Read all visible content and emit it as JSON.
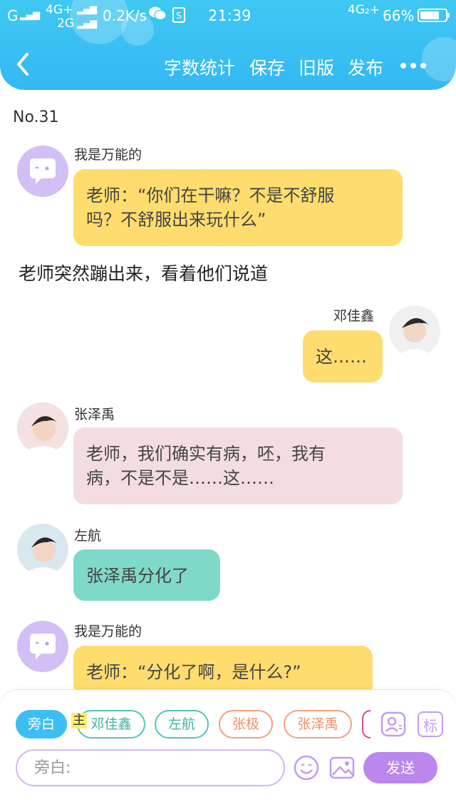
{
  "status_bar": {
    "carrier_left": "G",
    "network_1": "4G+",
    "network_2": "2G",
    "speed": "0.2K/s",
    "time": "21:39",
    "network_right": "4G₂+",
    "battery": "66%",
    "battery_level": 0.66,
    "icons": [
      "signal-icon",
      "wechat-icon",
      "sim-icon",
      "battery-icon"
    ]
  },
  "nav": {
    "back_icon": "chevron-left-icon",
    "actions": [
      "字数统计",
      "保存",
      "旧版",
      "发布"
    ],
    "more_icon": "more-dots-icon"
  },
  "chapter": {
    "number": "No.31"
  },
  "messages": [
    {
      "sender": "我是万能的",
      "text_line1": "老师：“你们在干嘛？不是不舒服",
      "text_line2": "吗？不舒服出来玩什么”",
      "side": "left",
      "color": "#fedd6e"
    },
    {
      "type": "narration",
      "text": "老师突然蹦出来，看着他们说道"
    },
    {
      "sender": "邓佳鑫",
      "text": "这……",
      "side": "right",
      "color": "#fedd6e"
    },
    {
      "sender": "张泽禹",
      "text_line1": "老师，我们确实有病，呸，我有",
      "text_line2": "病，不是不是……这……",
      "side": "left",
      "color": "#f4dde0"
    },
    {
      "sender": "左航",
      "text": "张泽禹分化了",
      "side": "left",
      "color": "#7fd9c8"
    },
    {
      "sender": "我是万能的",
      "text": "老师：“分化了啊，是什么?”",
      "side": "left",
      "color": "#fedd6e"
    }
  ],
  "composer": {
    "roles": [
      {
        "label": "旁白",
        "color": "#3cbef3",
        "active": true
      },
      {
        "label": "邓佳鑫",
        "color": "#4fc7b5"
      },
      {
        "label": "左航",
        "color": "#4fc7b5"
      },
      {
        "label": "张极",
        "color": "#f3a07e"
      },
      {
        "label": "张泽禹",
        "color": "#f3a07e"
      }
    ],
    "main_tag": "主",
    "role_icon": "person-card-icon",
    "tag_icon_label": "标",
    "input_placeholder": "旁白:",
    "emoji_icon": "smiley-icon",
    "image_icon": "image-icon",
    "send_label": "发送",
    "accent": "#bb86ed"
  }
}
